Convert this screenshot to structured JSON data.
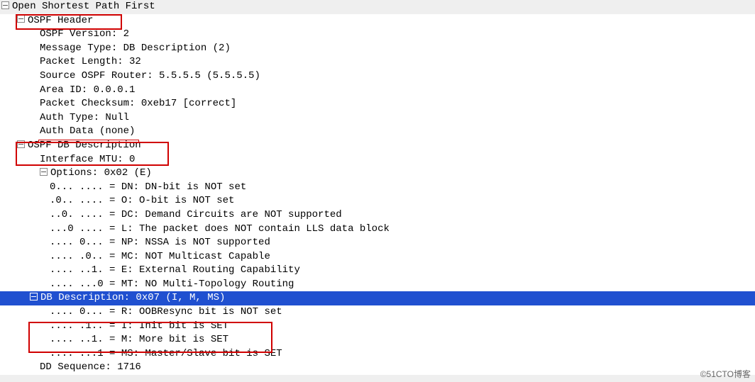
{
  "root": {
    "label": "Open Shortest Path First"
  },
  "header": {
    "title": "OSPF Header",
    "fields": {
      "version": "OSPF Version: 2",
      "msgtype": "Message Type: DB Description (2)",
      "pktlen": "Packet Length: 32",
      "srcrouter": "Source OSPF Router: 5.5.5.5 (5.5.5.5)",
      "areaid": "Area ID: 0.0.0.1",
      "checksum": "Packet Checksum: 0xeb17 [correct]",
      "authtype": "Auth Type: Null",
      "authdata": "Auth Data (none)"
    }
  },
  "dbdesc": {
    "title": "OSPF DB Description",
    "mtu": "Interface MTU: 0",
    "options_label": "Options: 0x02 (E)",
    "options": {
      "dn": "0... .... = DN: DN-bit is NOT set",
      "o": ".0.. .... = O: O-bit is NOT set",
      "dc": "..0. .... = DC: Demand Circuits are NOT supported",
      "l": "...0 .... = L: The packet does NOT contain LLS data block",
      "np": ".... 0... = NP: NSSA is NOT supported",
      "mc": ".... .0.. = MC: NOT Multicast Capable",
      "e": ".... ..1. = E: External Routing Capability",
      "mt": ".... ...0 = MT: NO Multi-Topology Routing"
    },
    "dbd_label": "DB Description: 0x07 (I, M, MS)",
    "dbd": {
      "r": ".... 0... = R: OOBResync bit is NOT set",
      "i": ".... .1.. = I: Init bit is SET",
      "m": ".... ..1. = M: More bit is SET",
      "ms": ".... ...1 = MS: Master/Slave bit is SET"
    },
    "ddseq": "DD Sequence: 1716"
  },
  "watermark": "©51CTO博客"
}
